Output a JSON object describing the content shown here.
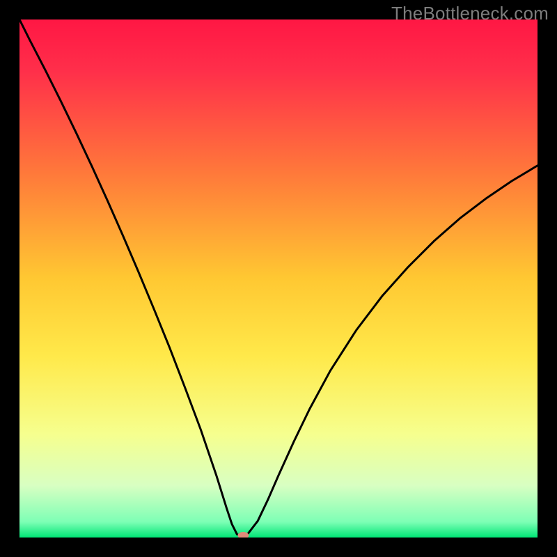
{
  "watermark": "TheBottleneck.com",
  "chart_data": {
    "type": "line",
    "title": "",
    "xlabel": "",
    "ylabel": "",
    "xlim": [
      0,
      100
    ],
    "ylim": [
      0,
      100
    ],
    "grid": false,
    "legend": false,
    "gradient_stops": [
      {
        "offset": 0.0,
        "color": "#ff1744"
      },
      {
        "offset": 0.1,
        "color": "#ff2f4a"
      },
      {
        "offset": 0.3,
        "color": "#ff7a3a"
      },
      {
        "offset": 0.5,
        "color": "#ffc832"
      },
      {
        "offset": 0.65,
        "color": "#ffe94a"
      },
      {
        "offset": 0.8,
        "color": "#f6ff8e"
      },
      {
        "offset": 0.9,
        "color": "#d8ffc2"
      },
      {
        "offset": 0.97,
        "color": "#7dffb5"
      },
      {
        "offset": 1.0,
        "color": "#00e676"
      }
    ],
    "series": [
      {
        "name": "bottleneck-curve",
        "color": "#000000",
        "width": 3,
        "x": [
          0.0,
          2.0,
          5.0,
          8.0,
          11.0,
          14.0,
          17.0,
          20.0,
          23.0,
          26.0,
          29.0,
          32.0,
          35.0,
          38.0,
          40.0,
          41.0,
          42.0,
          43.0,
          44.0,
          46.0,
          48.0,
          50.0,
          53.0,
          56.0,
          60.0,
          65.0,
          70.0,
          75.0,
          80.0,
          85.0,
          90.0,
          95.0,
          100.0
        ],
        "y": [
          100.0,
          96.0,
          90.2,
          84.2,
          78.0,
          71.6,
          65.0,
          58.2,
          51.2,
          44.0,
          36.6,
          28.8,
          20.8,
          12.0,
          5.6,
          2.6,
          0.6,
          0.2,
          0.6,
          3.2,
          7.4,
          12.0,
          18.6,
          24.8,
          32.2,
          40.0,
          46.6,
          52.2,
          57.2,
          61.6,
          65.4,
          68.8,
          71.8
        ]
      }
    ],
    "marker": {
      "name": "optimum-marker",
      "x": 43.2,
      "y": 0.4,
      "color": "#e08a7a",
      "rx": 8,
      "ry": 5
    }
  }
}
